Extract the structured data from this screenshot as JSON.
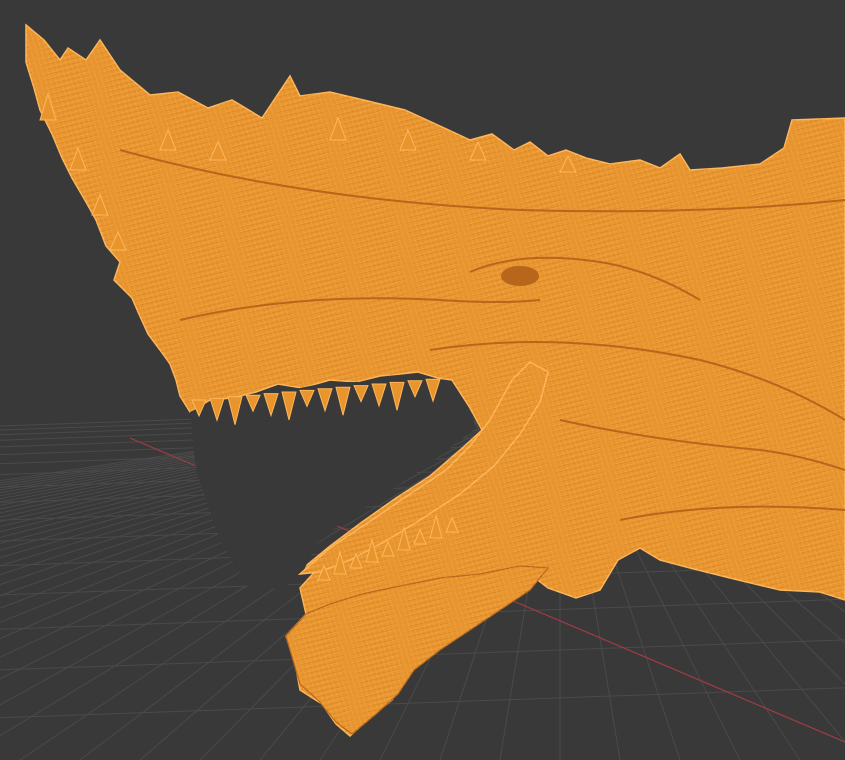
{
  "viewport": {
    "background_color": "#393939",
    "grid_color": "#4a4a4a",
    "x_axis_color": "#a33b45",
    "mesh_color": "#e8952e",
    "mesh_line_color": "#ffb75a",
    "mesh_shadow_color": "#b8661c",
    "display_mode": "wireframe",
    "object_icon": "dragon-head-mesh-icon"
  }
}
